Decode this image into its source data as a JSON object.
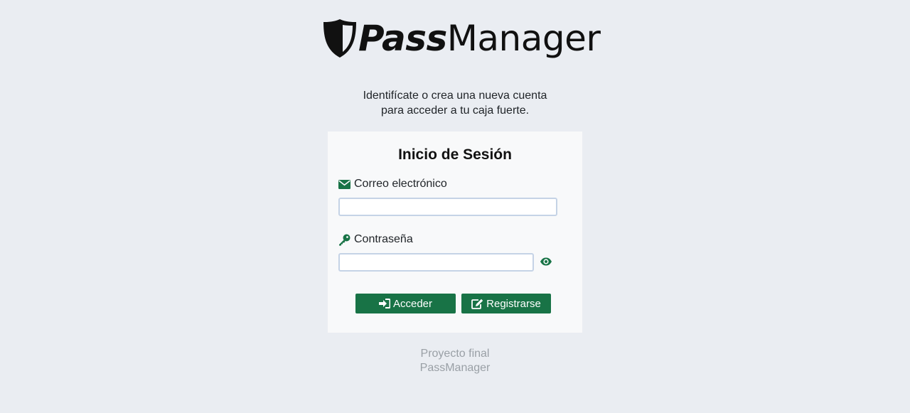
{
  "logo": {
    "icon": "shield-icon",
    "text_bold": "Pass",
    "text_regular": "Manager"
  },
  "intro": {
    "line1": "Identifícate o crea una nueva cuenta",
    "line2": "para acceder a tu caja fuerte."
  },
  "login_card": {
    "title": "Inicio de Sesión",
    "email": {
      "icon": "envelope-icon",
      "label": "Correo electrónico",
      "value": "",
      "placeholder": ""
    },
    "password": {
      "icon": "key-icon",
      "label": "Contraseña",
      "value": "",
      "placeholder": "",
      "toggle_icon": "eye-icon"
    },
    "buttons": {
      "login_icon": "sign-in-icon",
      "login_label": "Acceder",
      "register_icon": "edit-icon",
      "register_label": "Registrarse"
    }
  },
  "footer": {
    "line1": "Proyecto final",
    "line2": "PassManager"
  },
  "colors": {
    "background": "#eaedf2",
    "card": "#f8f9fa",
    "accent": "#187346",
    "input_border": "#c5d3e6",
    "footer_text": "#9aa0a6"
  }
}
